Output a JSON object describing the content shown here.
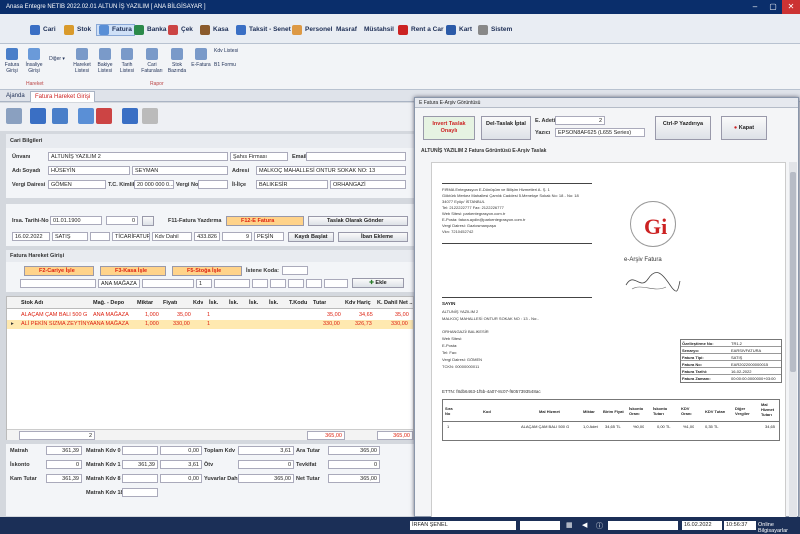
{
  "window": {
    "title": "Anasa Entegre NETIB 2022.02.01 ALTUN İŞ YAZILIM [ ANA BİLGİSAYAR ]"
  },
  "menu": [
    "Cari",
    "Stok",
    "Fatura",
    "Banka",
    "Çek",
    "Kasa",
    "Taksit - Senet",
    "Personel",
    "Masraf",
    "Müstahsil",
    "Rent a Car",
    "Kart",
    "Sistem"
  ],
  "ribbon": {
    "buttons": [
      "Fatura Girişi",
      "İnsaliye Girişi",
      "Diğer",
      "Hareket Listesi",
      "Bakiye Listesi",
      "Tarih Listesi",
      "Cari Faturaları",
      "Stok Bazında",
      "E-Fatura",
      "Kdv Listesi",
      "B1 Formu"
    ],
    "groups": [
      "Hareket",
      "Rapor"
    ]
  },
  "tabs": [
    "Ajanda",
    "Fatura Hareket Girişi"
  ],
  "cari": {
    "section": "Cari Bilgileri",
    "unvan_label": "Ünvanı",
    "unvan": "ALTUNİŞ YAZILIM 2",
    "sahis": "Şahıs Firması",
    "email_label": "Email",
    "adsoyad_label": "Adı Soyadı",
    "ad": "HÜSEYİN",
    "soyad": "SEYMAN",
    "adres_label": "Adresi",
    "adres": "MALKOÇ MAHALLESİ ONTUR SOKAK NO: 13",
    "vd_label": "Vergi Dairesi",
    "vd": "GÖMEN",
    "tc_label": "T.C. Kimlik",
    "tc": "20 000 000 0...",
    "vno_label": "Vergi No",
    "ilce_label": "İl-İlçe",
    "il": "BALIKESİR",
    "ilce": "ORHANGAZİ"
  },
  "irsaliye": {
    "tarih_label": "Irsa. Tarihi-No",
    "tarih": "01.01.1900",
    "no": "0",
    "yazdir": "F11-Fatura Yazdırma",
    "efatura": "F12-E Fatura",
    "taslak": "Taslak Olarak Gönder",
    "fatura_tarih": "16.02.2022",
    "satis": "SATIŞ",
    "tip": "TİCARİFATURA",
    "kdv": "Kdv Dahil",
    "tutar": "433.826",
    "vade": "9",
    "pesin": "PEŞİN",
    "kaydi_baslat": "Kaydı Başlat",
    "iban": "İban Ekleme"
  },
  "hareket": {
    "section": "Fatura Hareket Girişi",
    "f2": "F2-Cariye İşle",
    "f3": "F3-Kasa İşle",
    "f5": "F5-Stoğa İşle",
    "istenen": "İstene Koda:",
    "depo": "ANA MAĞAZA",
    "adet": "1",
    "ekle": "Ekle",
    "columns": [
      "Stok Adı",
      "Mağ. - Depo",
      "Miktar",
      "Fiyatı",
      "Kdv",
      "İsk.",
      "İsk.",
      "İsk.",
      "İsk.",
      "T.Kodu",
      "Tutar",
      "Kdv Hariç",
      "K. Dahil Net ..."
    ],
    "rows": [
      [
        "ALAÇAM ÇAM BALI 500 G",
        "ANA MAĞAZA",
        "1,000",
        "35,00",
        "1",
        "",
        "",
        "",
        "",
        "",
        "35,00",
        "34,65",
        "35,00"
      ],
      [
        "ALİ PEKİN SIZMA ZEYTİNYAĞ...",
        "ANA MAĞAZA",
        "1,000",
        "330,00",
        "1",
        "",
        "",
        "",
        "",
        "",
        "330,00",
        "326,73",
        "330,00"
      ]
    ],
    "footer_count": "2",
    "footer_tutar": "365,00",
    "footer_net": "365,00"
  },
  "totals": [
    {
      "label": "Matrah",
      "value": "361,39"
    },
    {
      "label": "Matrah Kdv 0",
      "value": ""
    },
    {
      "label": "Toplam Kdv",
      "value": "3,61"
    },
    {
      "label": "Ara Tutar",
      "value": "365,00"
    },
    {
      "label": "İskonto",
      "value": "0"
    },
    {
      "label": "Matrah Kdv 1",
      "value": "361,39"
    },
    {
      "label": "",
      "value": "3,61"
    },
    {
      "label": "Ötv",
      "value": "0"
    },
    {
      "label": "Tevkifat",
      "value": "0"
    },
    {
      "label": "Kam Tutar",
      "value": "361,39"
    },
    {
      "label": "Matrah Kdv 8",
      "value": "0,00"
    },
    {
      "label": "Yuvarlar Dahil",
      "value": "365,00"
    },
    {
      "label": "Net Tutar",
      "value": "365,00"
    },
    {
      "label": "Matrah Kdv 18",
      "value": ""
    }
  ],
  "dialog": {
    "title": "E Fatura E-Arşiv Görüntüsü",
    "invert": "Invert Taslak Onaylı",
    "del": "Del-Taslak İptal",
    "adet_label": "E. Adeti",
    "adet": "2",
    "yazici_label": "Yazıcı",
    "yazici": "EPSON8AF625 (L655 Series)",
    "ctrlp": "Ctrl-P Yazdırıya",
    "kapat": "Kapat",
    "doc_header": "ALTUNİŞ YAZILIM 2 Fatura Görüntüsü E-Arşiv Taslak",
    "firma": [
      "FIRMA Entegrasyon E-Dönüşüm ve Bilişim Hizmetleri A. Ş. 1",
      "Göktürk Merkez Mahallesi Çamlık Caddesi 5.Menekşe Sokak No: 18 - No: 18",
      "34077 Eyüp/ İSTANBUL",
      "Tel: 2122222777 Fax: 2122226777",
      "Web Sitesi: parkentegrasyon.com.tr",
      "E-Posta: fatura.aydin@parkentegrasyon.com.tr",
      "Vergi Dairesi: Gaziosmanpaşa",
      "Vkn: 7210452742"
    ],
    "earsiv": "e-Arşiv Fatura",
    "sayin": "SAYIN",
    "musteri": [
      "ALTUNİŞ YAZILIM 2",
      "MALKOÇ MAHALLESİ ONTUR SOKAK NO : 13 - No:-",
      "ORHANGAZİ/ BALIKESİR",
      "Web Sitesi:",
      "E-Posta:",
      "Tel: Fax:",
      "Vergi Dairesi: GÖMEN",
      "TCKN: 00000000011"
    ],
    "info": [
      [
        "Özelleştirme No:",
        "TR1.2"
      ],
      [
        "Senaryo:",
        "EARSIVFATURA"
      ],
      [
        "Fatura Tipi:",
        "SATIŞ"
      ],
      [
        "Fatura No:",
        "EAR2022000000015"
      ],
      [
        "Fatura Tarihi:",
        "16-02-2022"
      ],
      [
        "Fatura Zamanı:",
        "00:00:00.0000000+03:00"
      ]
    ],
    "ettn": "ETTN: f8db6463-1f5b-4a07-8c07-f6057393548ac",
    "cols": [
      "Sıra No",
      "Kod",
      "Mal Hizmet",
      "Miktar",
      "Birim Fiyat",
      "İskonto Oranı",
      "İskonto Tutarı",
      "KDV Oranı",
      "KDV Tutarı",
      "Diğer Vergiler",
      "Mal Hizmet Tutarı"
    ],
    "row1": [
      "1",
      "",
      "ALAÇAM ÇAM BALI 500 G",
      "1,0 Adet",
      "34,65 TL",
      "%0,00",
      "0,00 TL",
      "%1,00",
      "0,35 TL",
      "",
      "34,65"
    ]
  },
  "status": {
    "user": "İRFAN ŞENEL",
    "date": "16.02.2022",
    "time": "10:56:37",
    "online": "Online Bilgisayarlar"
  }
}
